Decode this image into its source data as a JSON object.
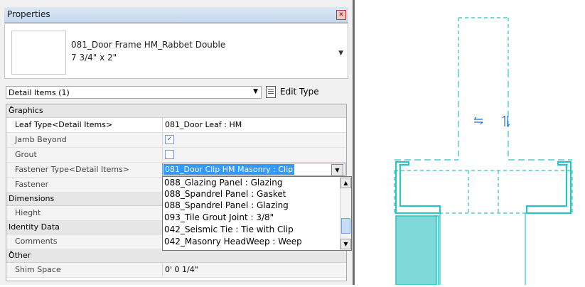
{
  "palette": {
    "title": "Properties",
    "close_glyph": "✕",
    "type_name": "081_Door Frame HM_Rabbet Double",
    "type_size": "7 3/4\" x 2\"",
    "filter": "Detail Items (1)",
    "edit_type": "Edit Type"
  },
  "groups": {
    "graphics": "Graphics",
    "dimensions": "Dimensions",
    "identity": "Identity Data",
    "other": "Other"
  },
  "params": {
    "leaf_type": {
      "name": "Leaf Type<Detail Items>",
      "value": "081_Door Leaf : HM"
    },
    "jamb_beyond": {
      "name": "Jamb Beyond",
      "checked": true
    },
    "grout": {
      "name": "Grout",
      "checked": false
    },
    "fastener_type": {
      "name": "Fastener Type<Detail Items>",
      "value": "081_Door Clip HM Masonry : Clip"
    },
    "fastener": {
      "name": "Fastener"
    },
    "hieght": {
      "name": "Hieght"
    },
    "comments": {
      "name": "Comments"
    },
    "shim_space": {
      "name": "Shim Space",
      "value": "0'  0 1/4\""
    }
  },
  "dropdown_options": [
    "088_Glazing Panel : Glazing",
    "088_Spandrel Panel : Gasket",
    "088_Spandrel Panel : Glazing",
    "093_Tile Grout Joint : 3/8\"",
    "042_Seismic Tie : Tie with Clip",
    "042_Masonry HeadWeep : Weep"
  ],
  "colors": {
    "detail_line": "#2ac4c4",
    "fill": "#7fd9d9",
    "selection": "#3399ff"
  },
  "icons": [
    "close-icon",
    "dropdown-arrow-icon",
    "edit-type-icon",
    "collapse-chevron-icon",
    "checkbox-icon",
    "scroll-up-icon",
    "scroll-down-icon",
    "flip-horizontal-icon",
    "flip-vertical-icon"
  ]
}
